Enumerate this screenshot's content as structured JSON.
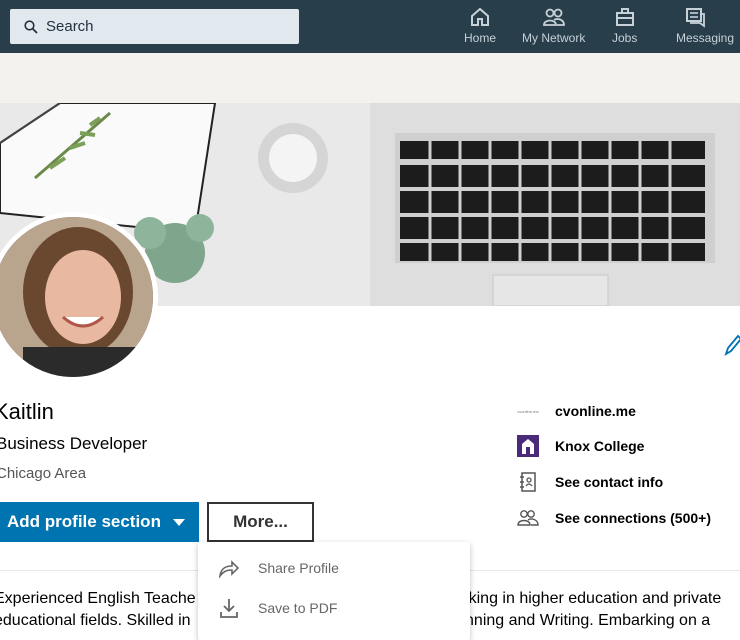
{
  "nav": {
    "search_placeholder": "Search",
    "items": [
      {
        "label": "Home",
        "icon": "home-icon"
      },
      {
        "label": "My Network",
        "icon": "network-icon"
      },
      {
        "label": "Jobs",
        "icon": "briefcase-icon"
      },
      {
        "label": "Messaging",
        "icon": "messaging-icon"
      }
    ]
  },
  "profile": {
    "name": "Kaitlin",
    "headline": "Business Developer",
    "location": "Chicago Area",
    "add_section_label": "Add profile section",
    "more_label": "More..."
  },
  "more_menu": {
    "items": [
      {
        "label": "Share Profile",
        "icon": "share-icon"
      },
      {
        "label": "Save to PDF",
        "icon": "download-icon"
      }
    ]
  },
  "sidebar": {
    "company": "cvonline.me",
    "company_logo_text": "cvonline.me",
    "school": "Knox College",
    "contact": "See contact info",
    "connections": "See connections (500+)"
  },
  "summary": {
    "line1_left": "Experienced English Teache",
    "line1_right": "king in higher education and private",
    "line2_left": "educational fields. Skilled in",
    "line2_right": "lanning and Writing. Embarking on a"
  },
  "colors": {
    "nav_bg": "#283e4a",
    "primary_button": "#0073b1",
    "school_logo": "#4a2a7a"
  }
}
